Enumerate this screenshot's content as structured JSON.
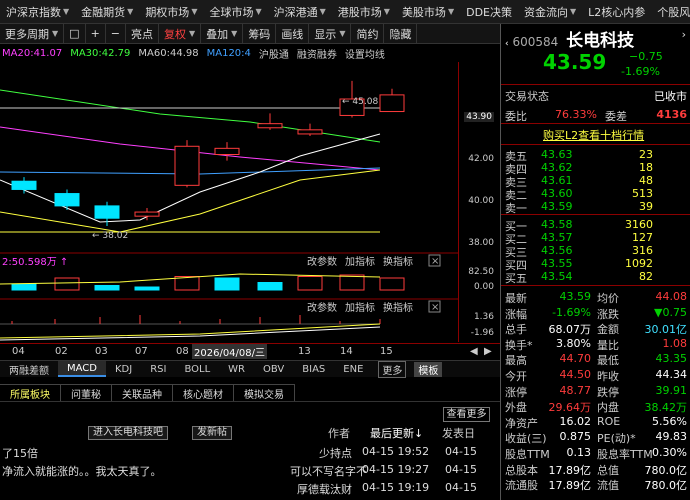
{
  "topbar": {
    "tabs": [
      {
        "label": "沪深京指数",
        "arrow": true
      },
      {
        "label": "金融期货",
        "arrow": true
      },
      {
        "label": "期权市场",
        "arrow": true
      },
      {
        "label": "全球市场",
        "arrow": true
      },
      {
        "label": "沪深港通",
        "arrow": true
      },
      {
        "label": "港股市场",
        "arrow": true
      },
      {
        "label": "美股市场",
        "arrow": true
      },
      {
        "label": "DDE决策",
        "arrow": false
      },
      {
        "label": "资金流向",
        "arrow": true
      },
      {
        "label": "L2核心内参",
        "arrow": false
      },
      {
        "label": "个股风",
        "arrow": false
      }
    ]
  },
  "toolbar": {
    "items": [
      "更多周期",
      "□",
      "+",
      "−",
      "亮点",
      "复权",
      "叠加",
      "筹码",
      "画线",
      "显示",
      "简约",
      "隐藏"
    ],
    "hot_index": 5
  },
  "maline": {
    "items": [
      {
        "text": "MA20:41.07",
        "color": "#ff40ff"
      },
      {
        "text": "MA30:42.79",
        "color": "#40ff40"
      },
      {
        "text": "MA60:44.98",
        "color": "#cccccc"
      },
      {
        "text": "MA120:4",
        "color": "#40a0ff"
      },
      {
        "text": "沪股通",
        "color": "#cccccc"
      },
      {
        "text": "融资融券",
        "color": "#cccccc"
      },
      {
        "text": "设置均线",
        "color": "#cccccc"
      }
    ]
  },
  "chart": {
    "axis_labels": [
      "43.90",
      "42.00",
      "40.00",
      "38.00"
    ],
    "high_label": "45.08",
    "low_label": "38.02",
    "vol_info": "2:50.598万",
    "vol_axis": [
      "82.50",
      "0.00"
    ],
    "macd_axis": [
      "1.36",
      "-1.96"
    ],
    "sub_buttons": [
      "改参数",
      "加指标",
      "换指标"
    ],
    "close_icon": "×"
  },
  "chart_data": {
    "type": "candlestick",
    "candles": [
      {
        "o": 40.2,
        "c": 39.8,
        "h": 40.4,
        "l": 39.6
      },
      {
        "o": 39.6,
        "c": 39.0,
        "h": 39.8,
        "l": 38.8
      },
      {
        "o": 39.0,
        "c": 38.4,
        "h": 39.2,
        "l": 38.02
      },
      {
        "o": 38.5,
        "c": 38.7,
        "h": 38.9,
        "l": 38.3
      },
      {
        "o": 40.0,
        "c": 41.9,
        "h": 42.2,
        "l": 39.9
      },
      {
        "o": 41.5,
        "c": 41.8,
        "h": 42.1,
        "l": 41.2
      },
      {
        "o": 42.8,
        "c": 43.0,
        "h": 43.5,
        "l": 42.7
      },
      {
        "o": 42.5,
        "c": 42.7,
        "h": 43.0,
        "l": 42.4
      },
      {
        "o": 43.4,
        "c": 44.2,
        "h": 45.08,
        "l": 43.3
      },
      {
        "o": 43.59,
        "c": 44.4,
        "h": 44.7,
        "l": 43.59
      }
    ],
    "ylim": [
      37.0,
      46.0
    ]
  },
  "datebar": {
    "dates": [
      "04",
      "02",
      "03",
      "07",
      "08",
      "13",
      "14",
      "15"
    ],
    "highlight": "2026/04/08/三"
  },
  "indtabs": {
    "items": [
      "两融差额",
      "MACD",
      "KDJ",
      "RSI",
      "BOLL",
      "WR",
      "OBV",
      "BIAS",
      "ENE"
    ],
    "selected": 1,
    "more": "更多",
    "template": "模板"
  },
  "infotabs": {
    "items": [
      "所属板块",
      "问董秘",
      "关联品种",
      "核心题材",
      "模拟交易"
    ],
    "selected": 0
  },
  "forum": {
    "view_more": "查看更多",
    "enter_btn": "进入长电科技吧",
    "post_btn": "发新帖",
    "author_col": "作者",
    "last_update_col": "最后更新↓",
    "post_time_col": "发表日"
  },
  "posts": [
    {
      "title": "了15倍",
      "author": "少持点",
      "time": "04-15 19:52",
      "date": "04-15"
    },
    {
      "title": "净流入就能涨的。。我太天真了。",
      "author": "可以不写名字不",
      "time": "04-15 19:27",
      "date": "04-15"
    },
    {
      "title": "",
      "author": "厚德载汰财",
      "time": "04-15 19:19",
      "date": "04-15"
    }
  ],
  "stock": {
    "code": "600584",
    "name": "长电科技",
    "price": "43.59",
    "change": "-0.75",
    "change_pct": "-1.69%",
    "status_label": "交易状态",
    "status": "已收市",
    "weibi_label": "委比",
    "weibi": "76.33%",
    "weicha_label": "委差",
    "weicha": "4136",
    "l2_link": "购买L2查看十档行情",
    "sells": [
      {
        "label": "卖五",
        "price": "43.63",
        "vol": "23"
      },
      {
        "label": "卖四",
        "price": "43.62",
        "vol": "18"
      },
      {
        "label": "卖三",
        "price": "43.61",
        "vol": "48"
      },
      {
        "label": "卖二",
        "price": "43.60",
        "vol": "513"
      },
      {
        "label": "卖一",
        "price": "43.59",
        "vol": "39"
      }
    ],
    "buys": [
      {
        "label": "买一",
        "price": "43.58",
        "vol": "3160"
      },
      {
        "label": "买二",
        "price": "43.57",
        "vol": "127"
      },
      {
        "label": "买三",
        "price": "43.56",
        "vol": "316"
      },
      {
        "label": "买四",
        "price": "43.55",
        "vol": "1092"
      },
      {
        "label": "买五",
        "price": "43.54",
        "vol": "82"
      }
    ],
    "stats": [
      {
        "l1": "最新",
        "v1": "43.59",
        "c1": "green",
        "l2": "均价",
        "v2": "44.08",
        "c2": "red"
      },
      {
        "l1": "涨幅",
        "v1": "-1.69%",
        "c1": "green",
        "l2": "涨跌",
        "v2": "▼0.75",
        "c2": "green"
      },
      {
        "l1": "总手",
        "v1": "68.07万",
        "c1": "white",
        "l2": "金额",
        "v2": "30.01亿",
        "c2": "cyan"
      },
      {
        "l1": "换手*",
        "v1": "3.80%",
        "c1": "white",
        "l2": "量比",
        "v2": "1.08",
        "c2": "red"
      },
      {
        "l1": "最高",
        "v1": "44.70",
        "c1": "red",
        "l2": "最低",
        "v2": "43.35",
        "c2": "green"
      },
      {
        "l1": "今开",
        "v1": "44.50",
        "c1": "red",
        "l2": "昨收",
        "v2": "44.34",
        "c2": "white"
      },
      {
        "l1": "涨停",
        "v1": "48.77",
        "c1": "red",
        "l2": "跌停",
        "v2": "39.91",
        "c2": "green"
      },
      {
        "l1": "外盘",
        "v1": "29.64万",
        "c1": "red",
        "l2": "内盘",
        "v2": "38.42万",
        "c2": "green"
      },
      {
        "l1": "净资产",
        "v1": "16.02",
        "c1": "white",
        "l2": "ROE",
        "v2": "5.56%",
        "c2": "white"
      },
      {
        "l1": "收益(三)",
        "v1": "0.875",
        "c1": "white",
        "l2": "PE(动)*",
        "v2": "49.83",
        "c2": "white"
      },
      {
        "l1": "股息TTM",
        "v1": "0.13",
        "c1": "white",
        "l2": "股息率TTM",
        "v2": "0.30%",
        "c2": "white"
      },
      {
        "l1": "总股本",
        "v1": "17.89亿",
        "c1": "white",
        "l2": "总值",
        "v2": "780.0亿",
        "c2": "white"
      },
      {
        "l1": "流通股",
        "v1": "17.89亿",
        "c1": "white",
        "l2": "流值",
        "v2": "780.0亿",
        "c2": "white"
      }
    ]
  }
}
